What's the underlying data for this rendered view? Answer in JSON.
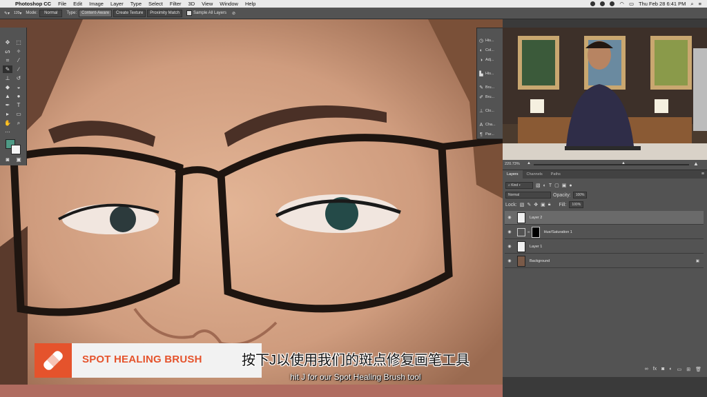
{
  "menubar": {
    "app_name": "Photoshop CC",
    "items": [
      "File",
      "Edit",
      "Image",
      "Layer",
      "Type",
      "Select",
      "Filter",
      "3D",
      "View",
      "Window",
      "Help"
    ],
    "clock": "Thu Feb 28  6:41 PM"
  },
  "options": {
    "brush_size": "120",
    "mode_label": "Mode:",
    "mode_value": "Normal",
    "type_label": "Type:",
    "type_options": [
      "Content-Aware",
      "Create Texture",
      "Proximity Match"
    ],
    "sample_all_label": "Sample All Layers"
  },
  "panel_strip": [
    "His...",
    "Col...",
    "Adj...",
    "His...",
    "Bru...",
    "Bru...",
    "Clo...",
    "Cha...",
    "Par..."
  ],
  "navigator": {
    "zoom": "220.73%"
  },
  "layers_panel": {
    "tabs": [
      "Layers",
      "Channels",
      "Paths"
    ],
    "kind_label": "Kind",
    "blend_mode": "Normal",
    "opacity_label": "Opacity:",
    "opacity_value": "100%",
    "lock_label": "Lock:",
    "fill_label": "Fill:",
    "fill_value": "100%",
    "layers": [
      {
        "name": "Layer 2",
        "selected": true
      },
      {
        "name": "Hue/Saturation 1",
        "selected": false
      },
      {
        "name": "Layer 1",
        "selected": false
      },
      {
        "name": "Background",
        "selected": false
      }
    ]
  },
  "lower_third": {
    "title": "SPOT HEALING BRUSH"
  },
  "subtitles": {
    "zh": "按下J以使用我们的斑点修复画笔工具",
    "en": "hit J for our Spot Healing Brush tool"
  },
  "colors": {
    "accent": "#e5532c",
    "panel": "#535353"
  }
}
